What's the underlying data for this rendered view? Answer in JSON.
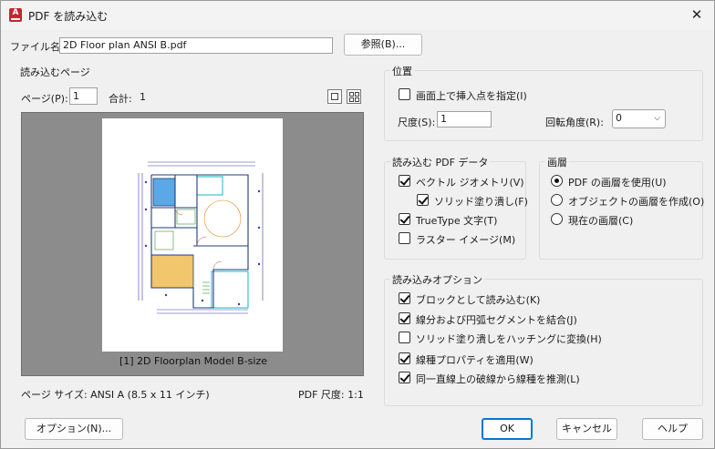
{
  "window": {
    "title": "PDF を読み込む",
    "close_glyph": "✕",
    "app_icon_letter": "A"
  },
  "file": {
    "label": "ファイル名:",
    "value": "2D Floor plan ANSI B.pdf",
    "browse": "参照(B)..."
  },
  "pages": {
    "group_label": "読み込むページ",
    "page_label": "ページ(P):",
    "page_value": "1",
    "total_label": "合計:",
    "total_value": "1",
    "caption": "[1] 2D Floorplan Model B-size",
    "page_size": "ページ サイズ: ANSI A (8.5 x 11 インチ)",
    "pdf_scale": "PDF 尺度: 1:1"
  },
  "position": {
    "group_label": "位置",
    "specify_on_screen": "画面上で挿入点を指定(I)",
    "specify_checked": false,
    "scale_label": "尺度(S):",
    "scale_value": "1",
    "rotation_label": "回転角度(R):",
    "rotation_value": "0"
  },
  "pdf_data": {
    "group_label": "読み込む PDF データ",
    "items": [
      {
        "label": "ベクトル ジオメトリ(V)",
        "checked": true
      },
      {
        "label": "ソリッド塗り潰し(F)",
        "checked": true
      },
      {
        "label": "TrueType 文字(T)",
        "checked": true
      },
      {
        "label": "ラスター イメージ(M)",
        "checked": false
      }
    ]
  },
  "layers": {
    "group_label": "画層",
    "options": [
      {
        "label": "PDF の画層を使用(U)",
        "selected": true
      },
      {
        "label": "オブジェクトの画層を作成(O)",
        "selected": false
      },
      {
        "label": "現在の画層(C)",
        "selected": false
      }
    ]
  },
  "import_options": {
    "group_label": "読み込みオプション",
    "items": [
      {
        "label": "ブロックとして読み込む(K)",
        "checked": true
      },
      {
        "label": "線分および円弧セグメントを結合(J)",
        "checked": true
      },
      {
        "label": "ソリッド塗り潰しをハッチングに変換(H)",
        "checked": false
      },
      {
        "label": "線種プロパティを適用(W)",
        "checked": true
      },
      {
        "label": "同一直線上の破線から線種を推測(L)",
        "checked": true
      }
    ]
  },
  "buttons": {
    "options": "オプション(N)...",
    "ok": "OK",
    "cancel": "キャンセル",
    "help": "ヘルプ"
  },
  "colors": {
    "accent": "#0078d4",
    "preview_bg": "#8c8c8c",
    "app_icon": "#c4262e"
  }
}
